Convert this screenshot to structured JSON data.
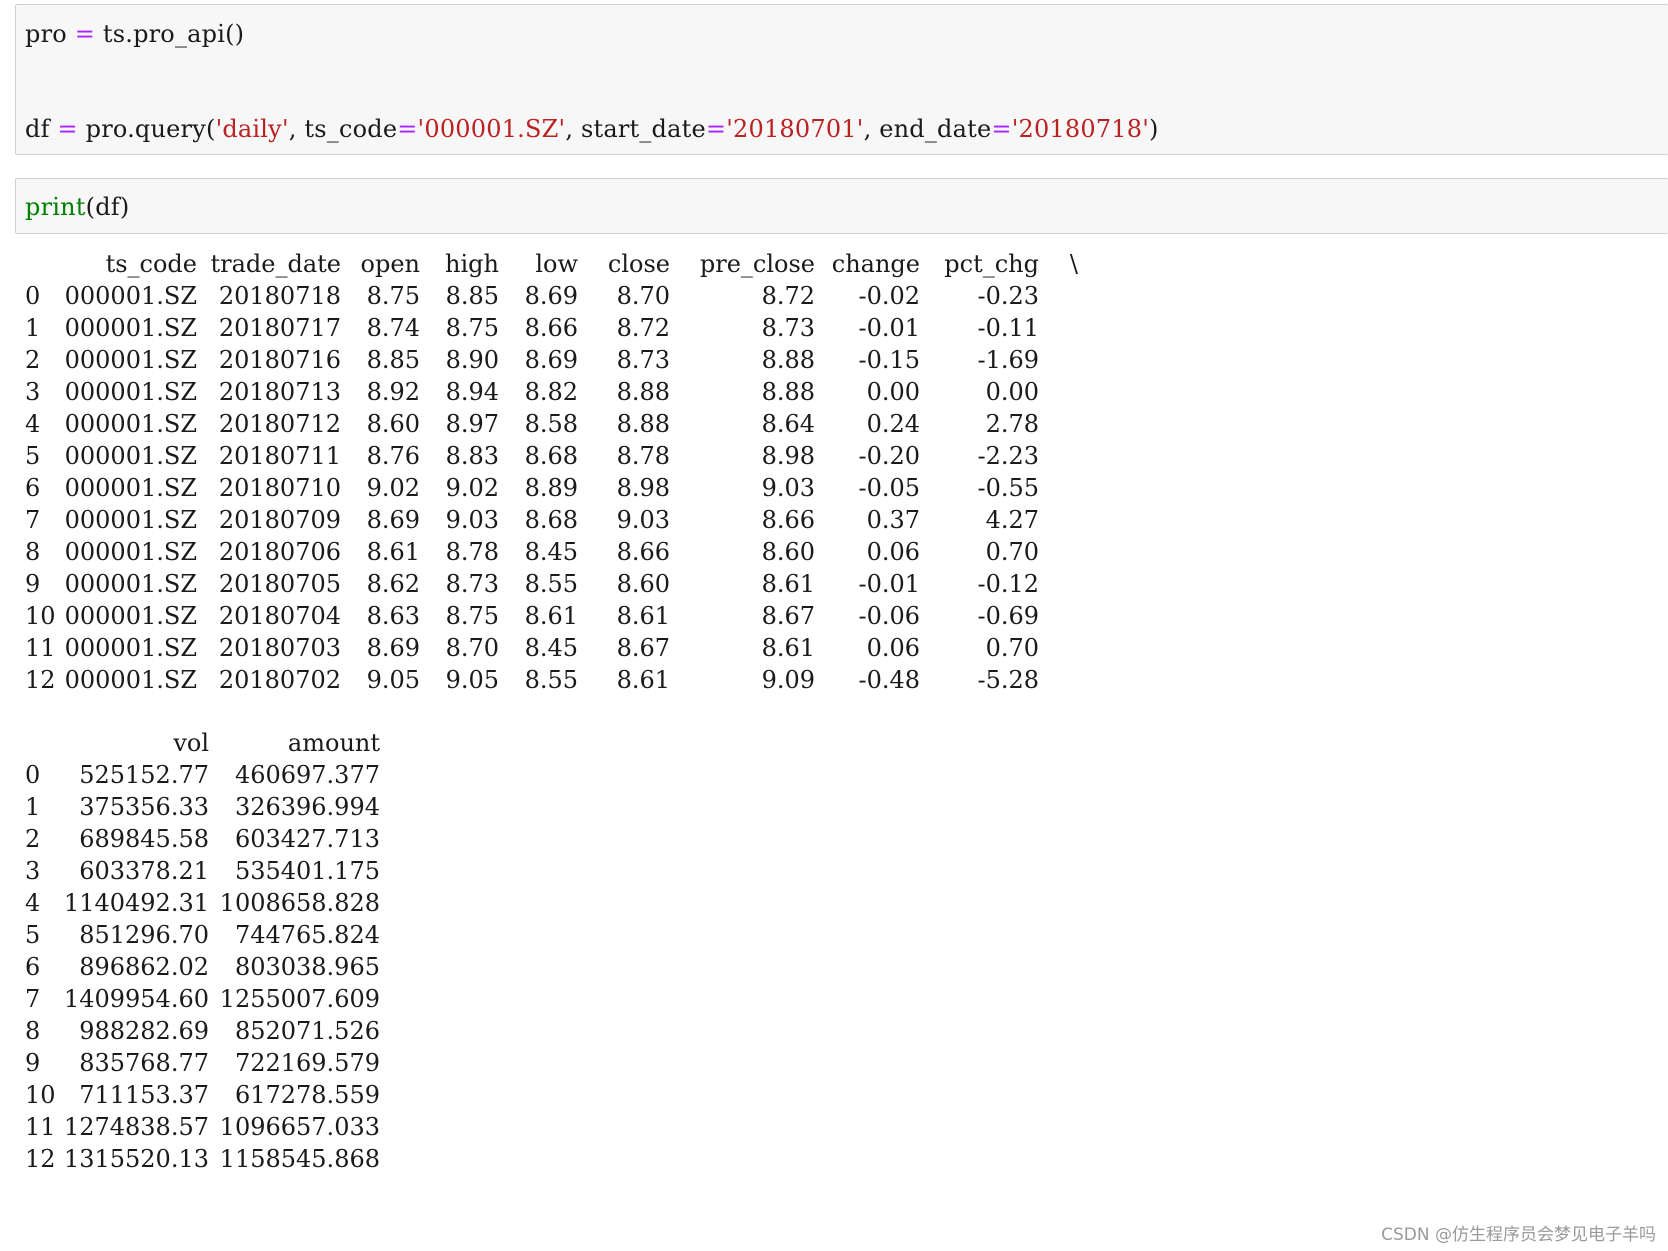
{
  "cell1": {
    "line1": {
      "var": "pro",
      "eq": "=",
      "rest": " ts.pro_api()"
    },
    "line2": {
      "var": "df",
      "eq": "=",
      "call": " pro.query(",
      "arg1": "'daily'",
      "sep1": ", ts_code",
      "eq1": "=",
      "arg2": "'000001.SZ'",
      "sep2": ", start_date",
      "eq2": "=",
      "arg3": "'20180701'",
      "sep3": ", end_date",
      "eq3": "=",
      "arg4": "'20180718'",
      "close": ")"
    }
  },
  "cell2": {
    "func": "print",
    "args": "(df)"
  },
  "table1": {
    "headers": [
      "ts_code",
      "trade_date",
      "open",
      "high",
      "low",
      "close",
      "pre_close",
      "change",
      "pct_chg",
      "\\"
    ],
    "rows": [
      [
        "0",
        "000001.SZ",
        "20180718",
        "8.75",
        "8.85",
        "8.69",
        "8.70",
        "8.72",
        "-0.02",
        "-0.23"
      ],
      [
        "1",
        "000001.SZ",
        "20180717",
        "8.74",
        "8.75",
        "8.66",
        "8.72",
        "8.73",
        "-0.01",
        "-0.11"
      ],
      [
        "2",
        "000001.SZ",
        "20180716",
        "8.85",
        "8.90",
        "8.69",
        "8.73",
        "8.88",
        "-0.15",
        "-1.69"
      ],
      [
        "3",
        "000001.SZ",
        "20180713",
        "8.92",
        "8.94",
        "8.82",
        "8.88",
        "8.88",
        "0.00",
        "0.00"
      ],
      [
        "4",
        "000001.SZ",
        "20180712",
        "8.60",
        "8.97",
        "8.58",
        "8.88",
        "8.64",
        "0.24",
        "2.78"
      ],
      [
        "5",
        "000001.SZ",
        "20180711",
        "8.76",
        "8.83",
        "8.68",
        "8.78",
        "8.98",
        "-0.20",
        "-2.23"
      ],
      [
        "6",
        "000001.SZ",
        "20180710",
        "9.02",
        "9.02",
        "8.89",
        "8.98",
        "9.03",
        "-0.05",
        "-0.55"
      ],
      [
        "7",
        "000001.SZ",
        "20180709",
        "8.69",
        "9.03",
        "8.68",
        "9.03",
        "8.66",
        "0.37",
        "4.27"
      ],
      [
        "8",
        "000001.SZ",
        "20180706",
        "8.61",
        "8.78",
        "8.45",
        "8.66",
        "8.60",
        "0.06",
        "0.70"
      ],
      [
        "9",
        "000001.SZ",
        "20180705",
        "8.62",
        "8.73",
        "8.55",
        "8.60",
        "8.61",
        "-0.01",
        "-0.12"
      ],
      [
        "10",
        "000001.SZ",
        "20180704",
        "8.63",
        "8.75",
        "8.61",
        "8.61",
        "8.67",
        "-0.06",
        "-0.69"
      ],
      [
        "11",
        "000001.SZ",
        "20180703",
        "8.69",
        "8.70",
        "8.45",
        "8.67",
        "8.61",
        "0.06",
        "0.70"
      ],
      [
        "12",
        "000001.SZ",
        "20180702",
        "9.05",
        "9.05",
        "8.55",
        "8.61",
        "9.09",
        "-0.48",
        "-5.28"
      ]
    ]
  },
  "table2": {
    "headers": [
      "vol",
      "amount"
    ],
    "rows": [
      [
        "0",
        "525152.77",
        "460697.377"
      ],
      [
        "1",
        "375356.33",
        "326396.994"
      ],
      [
        "2",
        "689845.58",
        "603427.713"
      ],
      [
        "3",
        "603378.21",
        "535401.175"
      ],
      [
        "4",
        "1140492.31",
        "1008658.828"
      ],
      [
        "5",
        "851296.70",
        "744765.824"
      ],
      [
        "6",
        "896862.02",
        "803038.965"
      ],
      [
        "7",
        "1409954.60",
        "1255007.609"
      ],
      [
        "8",
        "988282.69",
        "852071.526"
      ],
      [
        "9",
        "835768.77",
        "722169.579"
      ],
      [
        "10",
        "711153.37",
        "617278.559"
      ],
      [
        "11",
        "1274838.57",
        "1096657.033"
      ],
      [
        "12",
        "1315520.13",
        "1158545.868"
      ]
    ]
  },
  "watermark": "CSDN @仿生程序员会梦见电子羊吗",
  "colors": {
    "operator": "#aa22ff",
    "string": "#ba2121",
    "keyword": "#008000",
    "cell_bg": "#f7f7f7"
  }
}
